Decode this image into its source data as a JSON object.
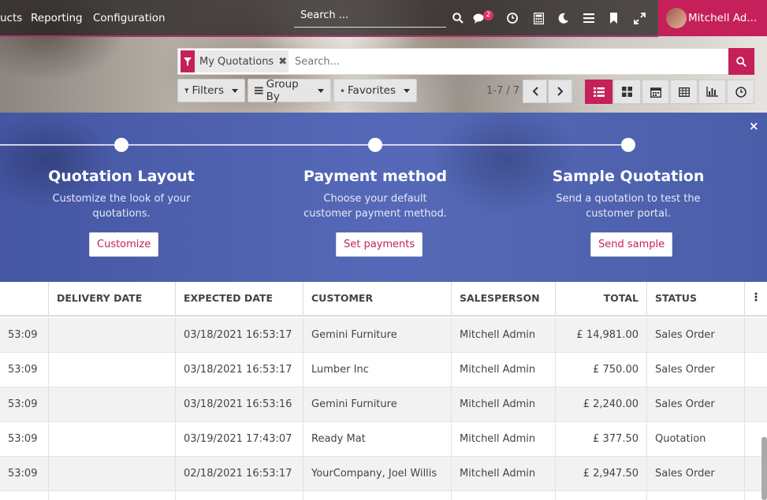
{
  "topnav": {
    "menu": [
      "ucts",
      "Reporting",
      "Configuration"
    ],
    "search_placeholder": "Search ...",
    "messages_count": "2",
    "user_name": "Mitchell Ad...",
    "icons": [
      "search-icon",
      "chat-icon",
      "clock-icon",
      "calculator-icon",
      "moon-icon",
      "menu-icon",
      "bookmark-icon",
      "expand-icon"
    ]
  },
  "control": {
    "facet_label": "My Quotations",
    "search_placeholder": "Search...",
    "filters_label": "Filters",
    "groupby_label": "Group By",
    "favorites_label": "Favorites",
    "pager_value": "1-7 / 7",
    "views": [
      "list",
      "kanban",
      "calendar",
      "pivot",
      "graph",
      "activity"
    ],
    "active_view": "list"
  },
  "banner": {
    "steps": [
      {
        "title": "Quotation Layout",
        "description": "Customize the look of your quotations.",
        "button": "Customize"
      },
      {
        "title": "Payment method",
        "description": "Choose your default customer payment method.",
        "button": "Set payments"
      },
      {
        "title": "Sample Quotation",
        "description": "Send a quotation to test the customer portal.",
        "button": "Send sample"
      }
    ],
    "close": "×"
  },
  "table": {
    "headers": [
      "",
      "DELIVERY DATE",
      "EXPECTED DATE",
      "CUSTOMER",
      "SALESPERSON",
      "TOTAL",
      "STATUS"
    ],
    "rows": [
      {
        "c0": "53:09",
        "delivery": "",
        "expected": "03/18/2021 16:53:17",
        "customer": "Gemini Furniture",
        "salesperson": "Mitchell Admin",
        "total": "£ 14,981.00",
        "status": "Sales Order"
      },
      {
        "c0": "53:09",
        "delivery": "",
        "expected": "03/18/2021 16:53:17",
        "customer": "Lumber Inc",
        "salesperson": "Mitchell Admin",
        "total": "£ 750.00",
        "status": "Sales Order"
      },
      {
        "c0": "53:09",
        "delivery": "",
        "expected": "03/18/2021 16:53:16",
        "customer": "Gemini Furniture",
        "salesperson": "Mitchell Admin",
        "total": "£ 2,240.00",
        "status": "Sales Order"
      },
      {
        "c0": "53:09",
        "delivery": "",
        "expected": "03/19/2021 17:43:07",
        "customer": "Ready Mat",
        "salesperson": "Mitchell Admin",
        "total": "£ 377.50",
        "status": "Quotation"
      },
      {
        "c0": "53:09",
        "delivery": "",
        "expected": "02/18/2021 16:53:17",
        "customer": "YourCompany, Joel Willis",
        "salesperson": "Mitchell Admin",
        "total": "£ 2,947.50",
        "status": "Sales Order"
      }
    ]
  }
}
